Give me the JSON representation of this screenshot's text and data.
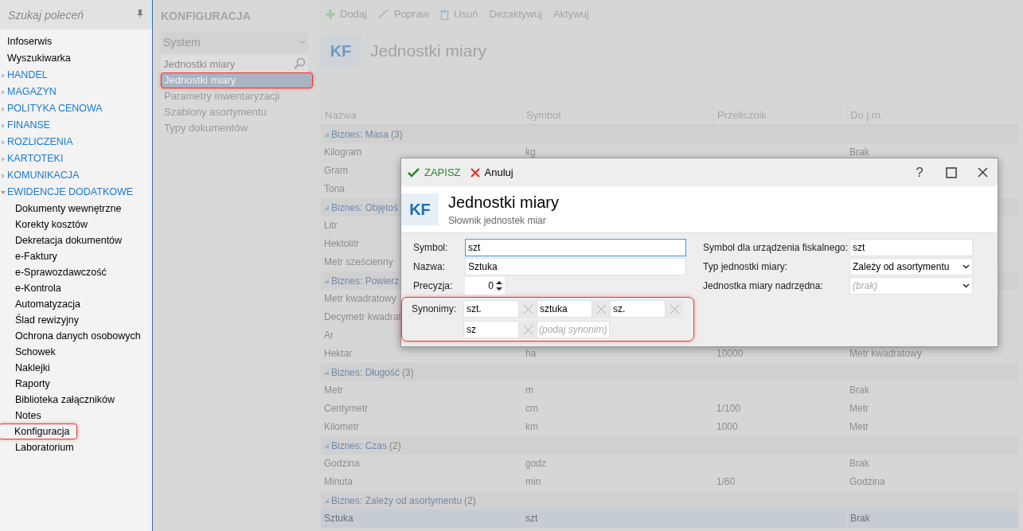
{
  "sidebar": {
    "search_placeholder": "Szukaj poleceń",
    "items": [
      {
        "kind": "link",
        "label": "Infoserwis"
      },
      {
        "kind": "link",
        "label": "Wyszukiwarka"
      },
      {
        "kind": "group",
        "label": "HANDEL",
        "expanded": false
      },
      {
        "kind": "group",
        "label": "MAGAZYN",
        "expanded": false
      },
      {
        "kind": "group",
        "label": "POLITYKA CENOWA",
        "expanded": false
      },
      {
        "kind": "group",
        "label": "FINANSE",
        "expanded": false
      },
      {
        "kind": "group",
        "label": "ROZLICZENIA",
        "expanded": false
      },
      {
        "kind": "group",
        "label": "KARTOTEKI",
        "expanded": false
      },
      {
        "kind": "group",
        "label": "KOMUNIKACJA",
        "expanded": false
      },
      {
        "kind": "group",
        "label": "EWIDENCJE DODATKOWE",
        "expanded": true,
        "children": [
          {
            "label": "Dokumenty wewnętrzne",
            "selected": false
          },
          {
            "label": "Korekty kosztów",
            "selected": false
          },
          {
            "label": "Dekretacja dokumentów",
            "selected": false
          },
          {
            "label": "e-Faktury",
            "selected": false
          },
          {
            "label": "e-Sprawozdawczość",
            "selected": false
          },
          {
            "label": "e-Kontrola",
            "selected": false
          },
          {
            "label": "Automatyzacja",
            "selected": false
          },
          {
            "label": "Ślad rewizyjny",
            "selected": false
          },
          {
            "label": "Ochrona danych osobowych",
            "selected": false
          },
          {
            "label": "Schowek",
            "selected": false
          },
          {
            "label": "Naklejki",
            "selected": false
          },
          {
            "label": "Raporty",
            "selected": false
          },
          {
            "label": "Biblioteka załączników",
            "selected": false
          },
          {
            "label": "Notes",
            "selected": false
          },
          {
            "label": "Konfiguracja",
            "selected": true
          },
          {
            "label": "Laboratorium",
            "selected": false
          }
        ]
      }
    ]
  },
  "config_panel": {
    "title": "KONFIGURACJA",
    "dropdown": "System",
    "search_value": "Jednostki miary",
    "items": [
      {
        "label": "Jednostki miary",
        "selected": true
      },
      {
        "label": "Parametry inwentaryzacji",
        "selected": false
      },
      {
        "label": "Szablony asortymentu",
        "selected": false
      },
      {
        "label": "Typy dokumentów",
        "selected": false
      }
    ]
  },
  "toolbar": [
    {
      "kind": "add",
      "label": "Dodaj"
    },
    {
      "kind": "edit",
      "label": "Popraw"
    },
    {
      "kind": "delete",
      "label": "Usuń"
    },
    {
      "kind": "text",
      "label": "Dezaktywuj"
    },
    {
      "kind": "text",
      "label": "Aktywuj"
    }
  ],
  "page_header": {
    "badge": "KF",
    "title": "Jednostki miary"
  },
  "table": {
    "columns": [
      "Nazwa",
      "Symbol",
      "Przelicznik",
      "Do j.m."
    ],
    "groups": [
      {
        "label": "Biznes: Masa",
        "count": "(3)",
        "rows": [
          {
            "cells": [
              "Kilogram",
              "kg",
              null,
              "Brak"
            ],
            "selected": false
          },
          {
            "cells": [
              "Gram",
              null,
              null,
              null
            ],
            "selected": false
          },
          {
            "cells": [
              "Tona",
              null,
              null,
              null
            ],
            "selected": false
          }
        ]
      },
      {
        "label": "Biznes: Objętoś",
        "rows": [
          {
            "cells": [
              "Litr",
              null,
              null,
              null
            ],
            "selected": false
          },
          {
            "cells": [
              "Hektolitr",
              null,
              null,
              null
            ],
            "selected": false
          },
          {
            "cells": [
              "Metr sześcienny",
              null,
              null,
              null
            ],
            "selected": false
          }
        ]
      },
      {
        "label": "Biznes: Powierz",
        "rows": [
          {
            "cells": [
              "Metr kwadratowy",
              null,
              null,
              null
            ],
            "selected": false
          },
          {
            "cells": [
              "Decymetr kwadrat",
              null,
              null,
              null
            ],
            "selected": false
          },
          {
            "cells": [
              "Ar",
              null,
              null,
              null
            ],
            "selected": false
          },
          {
            "cells": [
              "Hektar",
              "ha",
              "10000",
              "Metr kwadratowy"
            ],
            "selected": false
          }
        ]
      },
      {
        "label": "Biznes: Długość",
        "count": "(3)",
        "rows": [
          {
            "cells": [
              "Metr",
              "m",
              null,
              "Brak"
            ],
            "selected": false
          },
          {
            "cells": [
              "Centymetr",
              "cm",
              "1/100",
              "Metr"
            ],
            "selected": false
          },
          {
            "cells": [
              "Kilometr",
              "km",
              "1000",
              "Metr"
            ],
            "selected": false
          }
        ]
      },
      {
        "label": "Biznes: Czas",
        "count": "(2)",
        "rows": [
          {
            "cells": [
              "Godzina",
              "godz",
              null,
              "Brak"
            ],
            "selected": false
          },
          {
            "cells": [
              "Minuta",
              "min",
              "1/60",
              "Godzina"
            ],
            "selected": false
          }
        ]
      },
      {
        "label": "Biznes: Zależy od asortymentu",
        "count": "(2)",
        "rows": [
          {
            "cells": [
              "Sztuka",
              "szt",
              null,
              "Brak"
            ],
            "selected": true
          }
        ]
      }
    ]
  },
  "dialog": {
    "save": "ZAPISZ",
    "cancel": "Anuluj",
    "help": "?",
    "badge": "KF",
    "title": "Jednostki miary",
    "subtitle": "Słownik jednostek miar",
    "symbol_label": "Symbol:",
    "symbol_value": "szt",
    "name_label": "Nazwa:",
    "name_value": "Sztuka",
    "precision_label": "Precyzja:",
    "precision_value": "0",
    "synonyms_label": "Synonimy:",
    "synonyms": [
      "szt.",
      "sztuka",
      "sz.",
      "sz"
    ],
    "synonym_placeholder": "(podaj synonim)",
    "fiscal_label": "Symbol dla urządzenia fiskalnego:",
    "fiscal_value": "szt",
    "type_label": "Typ jednostki miary:",
    "type_value": "Zależy od asortymentu",
    "parent_label": "Jednostka miary nadrzędna:",
    "parent_placeholder": "(brak)"
  }
}
